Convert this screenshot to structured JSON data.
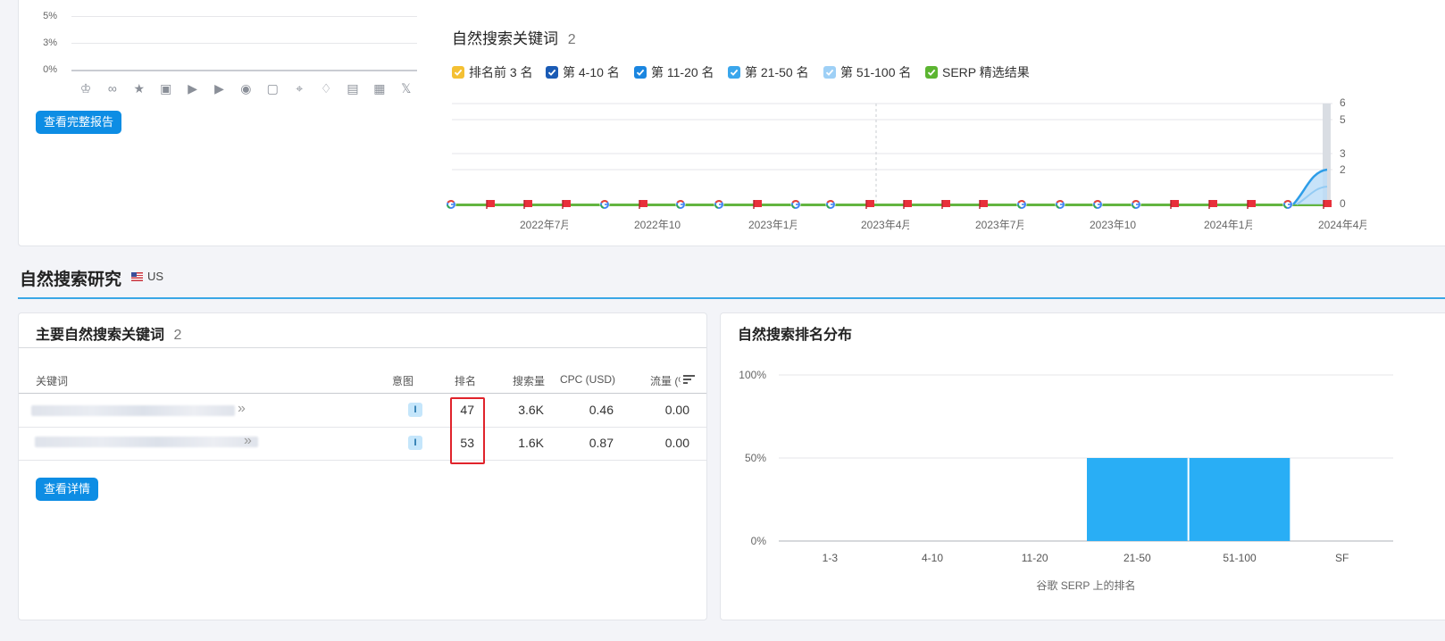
{
  "top_left": {
    "y_ticks": [
      "5%",
      "3%",
      "0%"
    ],
    "serp_icons": [
      "crown-icon",
      "link-icon",
      "star-icon",
      "image-icon",
      "play-icon",
      "video-icon",
      "play-circle-icon",
      "chat-icon",
      "location-icon",
      "graduation-cap-icon",
      "news-icon",
      "briefcase-icon",
      "x-logo-icon"
    ],
    "full_report_button": "查看完整报告"
  },
  "keywords_trend": {
    "title": "自然搜索关键词",
    "count": "2",
    "legend": [
      {
        "label": "排名前 3 名",
        "color": "#f4c033"
      },
      {
        "label": "第 4-10 名",
        "color": "#1a5bb5"
      },
      {
        "label": "第 11-20 名",
        "color": "#1b86e0"
      },
      {
        "label": "第 21-50 名",
        "color": "#3aa6ec"
      },
      {
        "label": "第 51-100 名",
        "color": "#9ed0f6"
      },
      {
        "label": "SERP 精选结果",
        "color": "#5cb531"
      }
    ],
    "y_ticks": [
      "6",
      "5",
      "3",
      "2",
      "0"
    ],
    "x_ticks": [
      "2022年7月",
      "2022年10",
      "2023年1月",
      "2023年4月",
      "2023年7月",
      "2023年10",
      "2024年1月",
      "2024年4月"
    ]
  },
  "section": {
    "title": "自然搜索研究",
    "country": "US"
  },
  "top_keywords": {
    "title": "主要自然搜索关键词",
    "count": "2",
    "columns": [
      "关键词",
      "意图",
      "排名",
      "搜索量",
      "CPC (USD)",
      "流量 (%"
    ],
    "rows": [
      {
        "intent": "I",
        "rank": "47",
        "volume": "3.6K",
        "cpc": "0.46",
        "traffic": "0.00"
      },
      {
        "intent": "I",
        "rank": "53",
        "volume": "1.6K",
        "cpc": "0.87",
        "traffic": "0.00"
      }
    ],
    "details_button": "查看详情"
  },
  "distribution": {
    "title": "自然搜索排名分布",
    "chart_data": {
      "type": "bar",
      "categories": [
        "1-3",
        "4-10",
        "11-20",
        "21-50",
        "51-100",
        "SF"
      ],
      "values": [
        0,
        0,
        0,
        50,
        50,
        0
      ],
      "y_ticks": [
        "100%",
        "50%",
        "0%"
      ],
      "ylim": [
        0,
        100
      ],
      "xlabel": "谷歌 SERP 上的排名",
      "color": "#29aef5"
    }
  }
}
